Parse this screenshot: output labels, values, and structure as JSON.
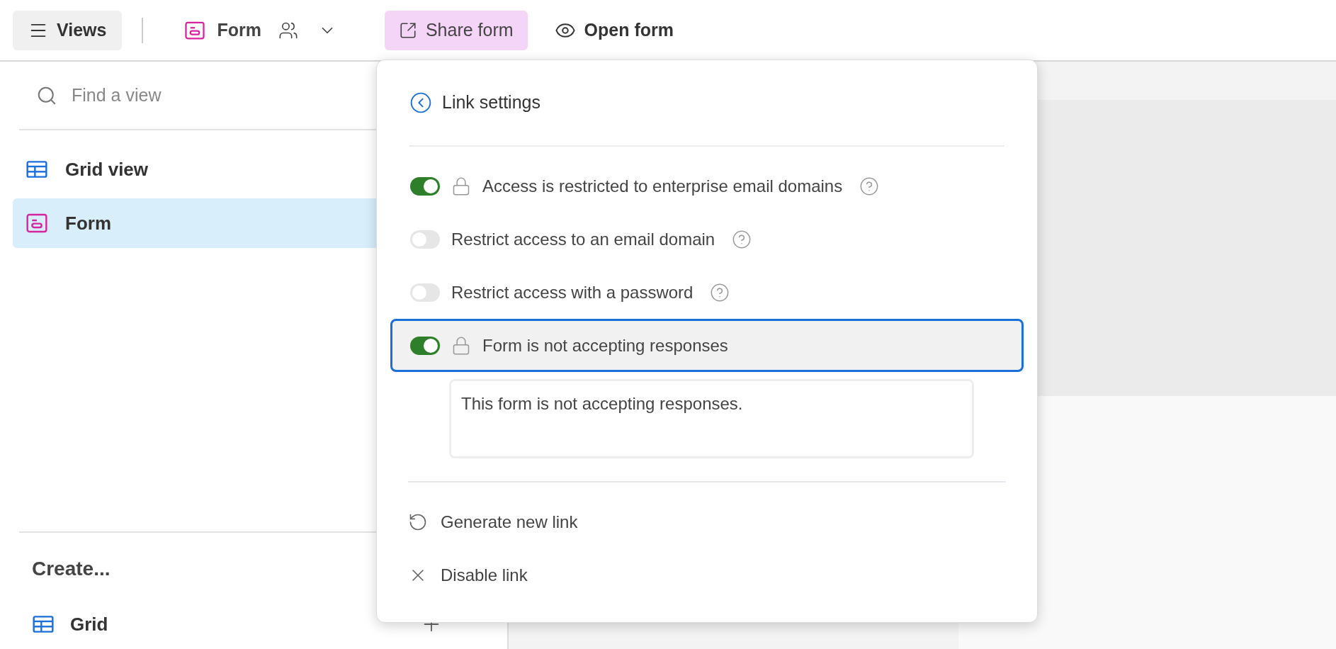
{
  "toolbar": {
    "views_button": "Views",
    "view_name": "Form",
    "share_button": {
      "label": "Share form",
      "selected": true
    },
    "open_button": "Open form"
  },
  "sidebar": {
    "search": {
      "placeholder": "Find a view"
    },
    "views": [
      {
        "kind": "grid",
        "label": "Grid view",
        "selected": false
      },
      {
        "kind": "form",
        "label": "Form",
        "selected": true
      }
    ],
    "create": {
      "title": "Create...",
      "items": [
        {
          "kind": "grid",
          "label": "Grid"
        }
      ]
    }
  },
  "popup": {
    "title": "Link settings",
    "settings": [
      {
        "label": "Access is restricted to enterprise email domains",
        "on": true,
        "locked": true,
        "help": true,
        "selected": false
      },
      {
        "label": "Restrict access to an email domain",
        "on": false,
        "locked": false,
        "help": true,
        "selected": false
      },
      {
        "label": "Restrict access with a password",
        "on": false,
        "locked": false,
        "help": true,
        "selected": false
      },
      {
        "label": "Form is not accepting responses",
        "on": true,
        "locked": true,
        "help": false,
        "selected": true
      }
    ],
    "message": {
      "value": "This form is not accepting responses."
    },
    "actions": [
      {
        "kind": "regenerate",
        "label": "Generate new link"
      },
      {
        "kind": "disable",
        "label": "Disable link"
      }
    ]
  }
}
